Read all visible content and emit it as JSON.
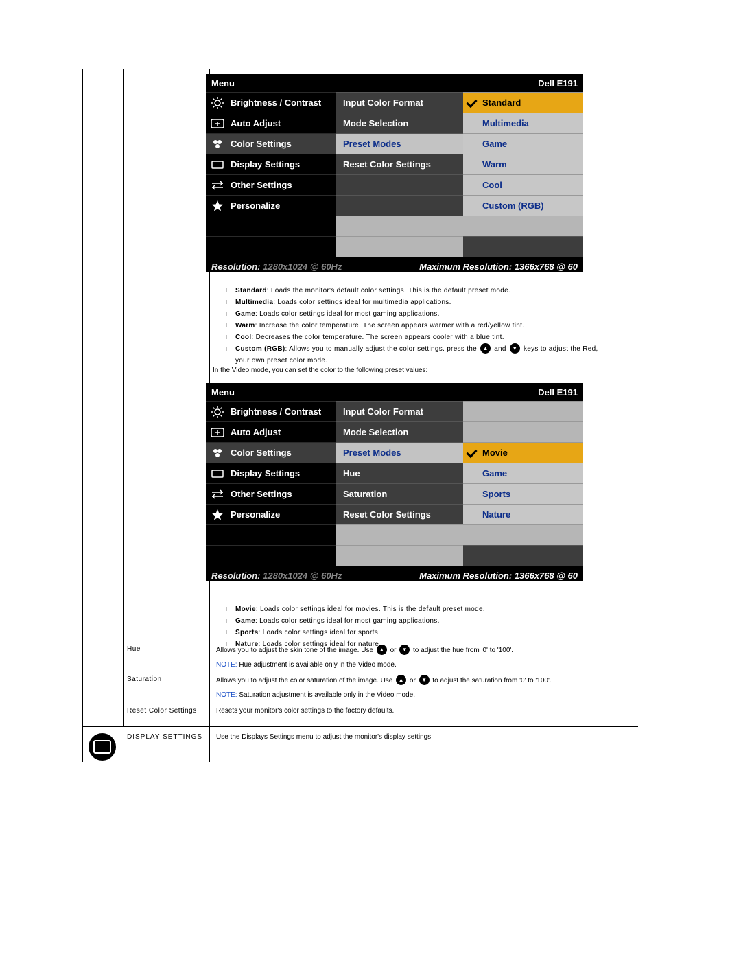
{
  "osd_common": {
    "menu_label": "Menu",
    "brand_label": "Dell E191",
    "footer_res_label": "Resolution:",
    "footer_res_value": "1280x1024 @ 60Hz",
    "footer_max_label": "Maximum Resolution: 1366x768 @ 60",
    "left_items": [
      {
        "icon": "brightness",
        "label": "Brightness / Contrast"
      },
      {
        "icon": "auto",
        "label": "Auto Adjust"
      },
      {
        "icon": "color",
        "label": "Color Settings"
      },
      {
        "icon": "display",
        "label": "Display Settings"
      },
      {
        "icon": "other",
        "label": "Other Settings"
      },
      {
        "icon": "star",
        "label": "Personalize"
      }
    ]
  },
  "osd1": {
    "mid": [
      "Input Color Format",
      "Mode Selection",
      "Preset Modes",
      "Reset Color Settings"
    ],
    "mid_active_index": 2,
    "right": [
      "Standard",
      "Multimedia",
      "Game",
      "Warm",
      "Cool",
      "Custom (RGB)"
    ],
    "right_active_index": 0
  },
  "osd2": {
    "mid": [
      "Input Color Format",
      "Mode Selection",
      "Preset Modes",
      "Hue",
      "Saturation",
      "Reset Color Settings"
    ],
    "mid_active_index": 2,
    "right": [
      "Movie",
      "Game",
      "Sports",
      "Nature"
    ],
    "right_active_index": 0
  },
  "preset_graphics_desc": {
    "items": [
      {
        "name": "Standard",
        "text": ": Loads the monitor's default color settings. This is the default preset mode."
      },
      {
        "name": "Multimedia",
        "text": ": Loads color settings ideal for multimedia applications."
      },
      {
        "name": "Game",
        "text": ": Loads color settings ideal for most gaming applications."
      },
      {
        "name": "Warm",
        "text": ": Increase the color temperature. The screen appears warmer with a red/yellow tint."
      },
      {
        "name": "Cool",
        "text": ": Decreases the color temperature. The screen appears cooler with a blue tint."
      }
    ],
    "custom_name": "Custom (RGB)",
    "custom_text_a": ": Allows you to manually adjust the color settings. press the ",
    "custom_text_b": " and ",
    "custom_text_c": " keys to adjust the Red,",
    "custom_text_tail": "your own preset color mode."
  },
  "video_intro": "In the Video mode, you can set the color to the following preset values:",
  "preset_video_desc": {
    "items": [
      {
        "name": "Movie",
        "text": ": Loads color settings ideal for movies. This is the default preset mode."
      },
      {
        "name": "Game",
        "text": ": Loads color settings ideal for most gaming applications."
      },
      {
        "name": "Sports",
        "text": ": Loads color settings ideal for sports."
      },
      {
        "name": "Nature",
        "text": ": Loads color settings ideal for nature."
      }
    ]
  },
  "rows": {
    "hue": {
      "label": "Hue",
      "line_a": "Allows you to adjust the skin tone of the image. Use ",
      "line_b": " or ",
      "line_c": " to adjust the hue from '0' to '100'.",
      "note_label": "NOTE:",
      "note_text": " Hue adjustment is available only in the Video mode."
    },
    "saturation": {
      "label": "Saturation",
      "line_a": "Allows you to adjust the color saturation of the image. Use ",
      "line_b": " or ",
      "line_c": " to adjust the saturation from '0' to '100'.",
      "note_label": "NOTE:",
      "note_text": " Saturation adjustment is available only in the Video mode."
    },
    "reset": {
      "label": "Reset Color Settings",
      "text": "Resets your monitor's color settings to the factory defaults."
    },
    "display": {
      "label": "DISPLAY SETTINGS",
      "text": "Use the Displays Settings menu to adjust the monitor's display settings."
    }
  }
}
